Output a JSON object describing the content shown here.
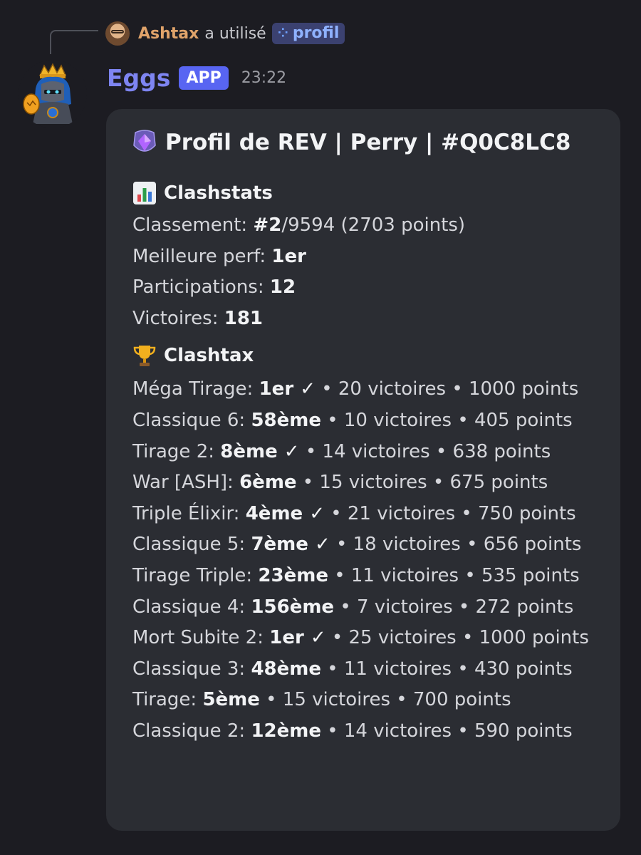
{
  "reply": {
    "user": "Ashtax",
    "text": "a utilisé",
    "command": "profil",
    "command_icon": "command-icon"
  },
  "message": {
    "username": "Eggs",
    "badge": "APP",
    "time": "23:22"
  },
  "embed": {
    "title": "Profil de REV | Perry | #Q0C8LC8",
    "title_icon": "purple-gem-icon",
    "sections": {
      "clashstats": {
        "icon": "bar-chart-icon",
        "title": "Clashstats",
        "rows": [
          {
            "label": "Classement: ",
            "bold": "#2",
            "rest": "/9594 (2703 points)"
          },
          {
            "label": "Meilleure perf: ",
            "bold": "1er",
            "rest": ""
          },
          {
            "label": "Participations: ",
            "bold": "12",
            "rest": ""
          },
          {
            "label": "Victoires: ",
            "bold": "181",
            "rest": ""
          }
        ]
      },
      "clashtax": {
        "icon": "trophy-icon",
        "title": "Clashtax",
        "rows": [
          {
            "label": "Méga Tirage: ",
            "bold": "1er ✓",
            "rest": " • 20 victoires • 1000 points"
          },
          {
            "label": "Classique 6: ",
            "bold": "58ème",
            "rest": " • 10 victoires • 405 points"
          },
          {
            "label": "Tirage 2: ",
            "bold": "8ème ✓",
            "rest": " • 14 victoires • 638 points"
          },
          {
            "label": "War [ASH]: ",
            "bold": "6ème",
            "rest": " • 15 victoires • 675 points"
          },
          {
            "label": "Triple Élixir: ",
            "bold": "4ème ✓",
            "rest": " • 21 victoires • 750 points"
          },
          {
            "label": "Classique 5: ",
            "bold": "7ème ✓",
            "rest": " • 18 victoires • 656 points"
          },
          {
            "label": "Tirage Triple: ",
            "bold": "23ème",
            "rest": " • 11 victoires • 535 points"
          },
          {
            "label": "Classique 4: ",
            "bold": "156ème",
            "rest": " • 7 victoires • 272 points"
          },
          {
            "label": "Mort Subite 2: ",
            "bold": "1er ✓",
            "rest": " • 25 victoires • 1000 points"
          },
          {
            "label": "Classique 3: ",
            "bold": "48ème",
            "rest": " • 11 victoires • 430 points"
          },
          {
            "label": "Tirage: ",
            "bold": "5ème",
            "rest": " • 15 victoires • 700 points"
          },
          {
            "label": "Classique 2: ",
            "bold": "12ème",
            "rest": " • 14 victoires • 590 points"
          }
        ]
      }
    }
  },
  "colors": {
    "background": "#1c1c22",
    "embed_bg": "#2b2d33",
    "username": "#7e85f2",
    "app_badge": "#5865f2",
    "reply_user": "#e0a36a",
    "command_pill": "#3b4170"
  }
}
